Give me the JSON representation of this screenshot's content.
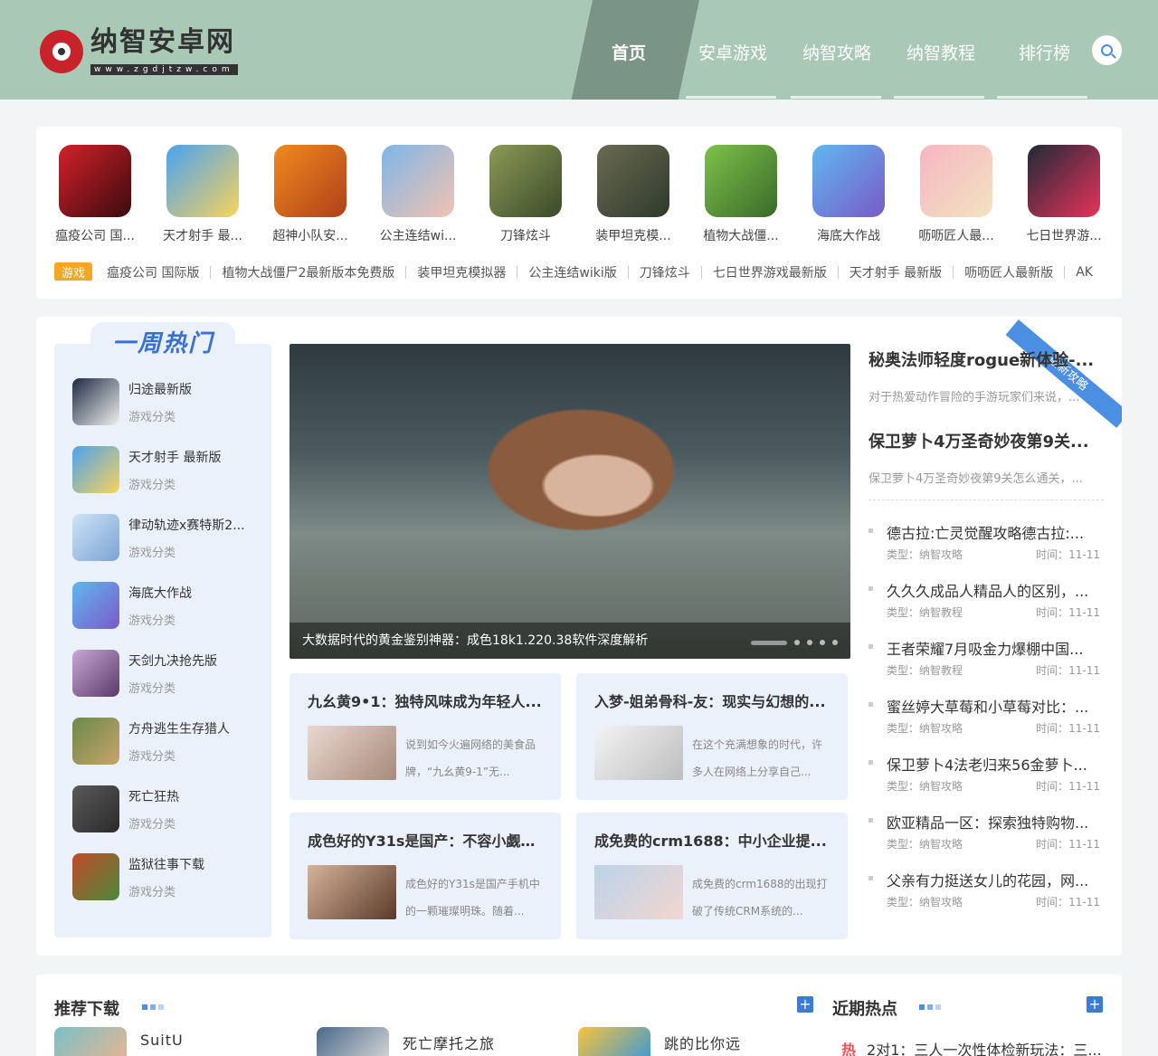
{
  "site": {
    "name": "纳智安卓网",
    "url": "www.zgdjtzw.com"
  },
  "nav": {
    "items": [
      {
        "label": "首页",
        "active": true
      },
      {
        "label": "安卓游戏",
        "active": false
      },
      {
        "label": "纳智攻略",
        "active": false
      },
      {
        "label": "纳智教程",
        "active": false
      },
      {
        "label": "排行榜",
        "active": false
      }
    ],
    "search_icon": "search-icon"
  },
  "games": [
    {
      "name": "瘟疫公司 国...",
      "colors": [
        "#d3212a",
        "#3a0b0e"
      ]
    },
    {
      "name": "天才射手 最...",
      "colors": [
        "#4aa2f0",
        "#f7d35a"
      ]
    },
    {
      "name": "超神小队安...",
      "colors": [
        "#f08a1e",
        "#b0401a"
      ]
    },
    {
      "name": "公主连结wi...",
      "colors": [
        "#7db6e8",
        "#f3c2b0"
      ]
    },
    {
      "name": "刀锋炫斗",
      "colors": [
        "#8a9a55",
        "#3b4a2a"
      ]
    },
    {
      "name": "装甲坦克模...",
      "colors": [
        "#6b6a52",
        "#2e3a2a"
      ]
    },
    {
      "name": "植物大战僵...",
      "colors": [
        "#7dc24a",
        "#3a6a2a"
      ]
    },
    {
      "name": "海底大作战",
      "colors": [
        "#5fb7ef",
        "#7a5ac8"
      ]
    },
    {
      "name": "呖呖匠人最...",
      "colors": [
        "#f7b5c3",
        "#f2e3c0"
      ]
    },
    {
      "name": "七日世界游...",
      "colors": [
        "#1f2a36",
        "#e8335b"
      ]
    }
  ],
  "tags": {
    "badge": "游戏",
    "items": [
      "瘟疫公司 国际版",
      "植物大战僵尸2最新版本免费版",
      "装甲坦克模拟器",
      "公主连结wiki版",
      "刀锋炫斗",
      "七日世界游戏最新版",
      "天才射手 最新版",
      "呖呖匠人最新版",
      "AK"
    ]
  },
  "weekly_hot": {
    "title": "一周热门",
    "items": [
      {
        "name": "归途最新版",
        "category": "游戏分类",
        "colors": [
          "#1e2a44",
          "#f0f0f0"
        ]
      },
      {
        "name": "天才射手 最新版",
        "category": "游戏分类",
        "colors": [
          "#4aa2f0",
          "#f7d35a"
        ]
      },
      {
        "name": "律动轨迹x赛特斯2...",
        "category": "游戏分类",
        "colors": [
          "#cfe3f5",
          "#7aa4d6"
        ]
      },
      {
        "name": "海底大作战",
        "category": "游戏分类",
        "colors": [
          "#5fb7ef",
          "#7a5ac8"
        ]
      },
      {
        "name": "天剑九决抢先版",
        "category": "游戏分类",
        "colors": [
          "#c9a7d6",
          "#5a3a6a"
        ]
      },
      {
        "name": "方舟逃生生存猎人",
        "category": "游戏分类",
        "colors": [
          "#6a8a4a",
          "#c9a36a"
        ]
      },
      {
        "name": "死亡狂热",
        "category": "游戏分类",
        "colors": [
          "#5a5a5a",
          "#2a2a2a"
        ]
      },
      {
        "name": "监狱往事下载",
        "category": "游戏分类",
        "colors": [
          "#c24a2a",
          "#4a8a3a"
        ]
      }
    ]
  },
  "slider": {
    "caption": "大数据时代的黄金鉴别神器：成色18k1.220.38软件深度解析",
    "dot_count": 5
  },
  "cards": [
    {
      "title": "九幺黄9•1：独特风味成为年轻人...",
      "desc": "说到如今火遍网络的美食品牌，“九幺黄9-1”无...",
      "colors": [
        "#e9d8d0",
        "#a88a7a"
      ]
    },
    {
      "title": "入梦-姐弟骨科-友：现实与幻想的...",
      "desc": "在这个充满想象的时代，许多人在网络上分享自己...",
      "colors": [
        "#f4f4f4",
        "#bdbdbd"
      ]
    },
    {
      "title": "成色好的Y31s是国产：不容小觑的...",
      "desc": "成色好的Y31s是国产手机中的一颗璀璨明珠。随着...",
      "colors": [
        "#d6b39a",
        "#5a3a2a"
      ]
    },
    {
      "title": "成免费的crm1688：中小企业提...",
      "desc": "成免费的crm1688的出现打破了传统CRM系统的...",
      "colors": [
        "#bcd3ea",
        "#f2d6d0"
      ]
    }
  ],
  "featured": {
    "ribbon": "最新攻略",
    "items": [
      {
        "title": "秘奥法师轻度rogue新体验-...",
        "desc": "对于热爱动作冒险的手游玩家们来说，..."
      },
      {
        "title": "保卫萝卜4万圣奇妙夜第9关...",
        "desc": "保卫萝卜4万圣奇妙夜第9关怎么通关，..."
      }
    ]
  },
  "news": [
    {
      "title": "德古拉:亡灵觉醒攻略德古拉:...",
      "type": "类型：纳智攻略",
      "time": "时间：11-11"
    },
    {
      "title": "久久久成品人精品人的区别，...",
      "type": "类型：纳智教程",
      "time": "时间：11-11"
    },
    {
      "title": "王者荣耀7月吸金力爆棚中国...",
      "type": "类型：纳智教程",
      "time": "时间：11-11"
    },
    {
      "title": "蜜丝婷大草莓和小草莓对比：...",
      "type": "类型：纳智攻略",
      "time": "时间：11-11"
    },
    {
      "title": "保卫萝卜4法老归来56金萝卜...",
      "type": "类型：纳智攻略",
      "time": "时间：11-11"
    },
    {
      "title": "欧亚精品一区：探索独特购物...",
      "type": "类型：纳智攻略",
      "time": "时间：11-11"
    },
    {
      "title": "父亲有力挺送女儿的花园，网...",
      "type": "类型：纳智攻略",
      "time": "时间：11-11"
    }
  ],
  "recommend": {
    "title": "推荐下载",
    "plus": "+",
    "items": [
      {
        "name": "SuitU",
        "colors": [
          "#7ac0c8",
          "#e8b590"
        ]
      },
      {
        "name": "死亡摩托之旅",
        "colors": [
          "#4a6a8a",
          "#d8d8d8"
        ]
      },
      {
        "name": "跳的比你远",
        "colors": [
          "#f7c23a",
          "#3a9ad8"
        ]
      }
    ]
  },
  "recent_hot": {
    "title": "近期热点",
    "plus": "+",
    "badge": "热",
    "first": "2对1：三人一次性体检新玩法：三..."
  }
}
